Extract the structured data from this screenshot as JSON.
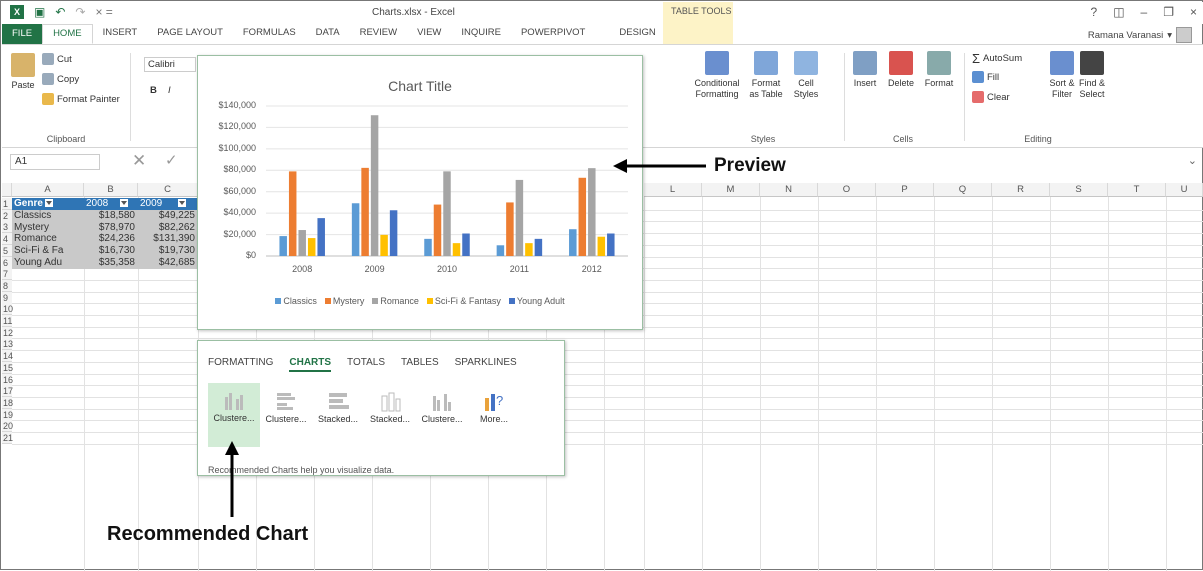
{
  "window": {
    "title": "Charts.xlsx - Excel",
    "context_tab_group": "TABLE TOOLS"
  },
  "ribbon_tabs": [
    "FILE",
    "HOME",
    "INSERT",
    "PAGE LAYOUT",
    "FORMULAS",
    "DATA",
    "REVIEW",
    "VIEW",
    "INQUIRE",
    "POWERPIVOT",
    "DESIGN"
  ],
  "user": {
    "name": "Ramana Varanasi"
  },
  "clipboard": {
    "paste": "Paste",
    "cut": "Cut",
    "copy": "Copy",
    "format_painter": "Format Painter",
    "label": "Clipboard"
  },
  "font": {
    "name": "Calibri",
    "bold": "B",
    "italic": "I"
  },
  "styles": {
    "conditional": "Conditional Formatting",
    "format_table": "Format as Table",
    "cell_styles": "Cell Styles",
    "label": "Styles"
  },
  "cells": {
    "insert": "Insert",
    "delete": "Delete",
    "format": "Format",
    "label": "Cells"
  },
  "editing": {
    "autosum": "AutoSum",
    "fill": "Fill",
    "clear": "Clear",
    "sort": "Sort & Filter",
    "find": "Find & Select",
    "label": "Editing"
  },
  "formula_bar": {
    "name_box": "A1"
  },
  "columns_visible": [
    "A",
    "B",
    "C",
    "L",
    "M",
    "N",
    "O",
    "P",
    "Q",
    "R",
    "S",
    "T",
    "U"
  ],
  "rows": [
    "1",
    "2",
    "3",
    "4",
    "5",
    "6",
    "7",
    "8",
    "9",
    "10",
    "11",
    "12",
    "13",
    "14",
    "15",
    "16",
    "17",
    "18",
    "19",
    "20",
    "21"
  ],
  "table": {
    "headers": [
      "Genre",
      "2008",
      "2009"
    ],
    "rows": [
      [
        "Classics",
        "$18,580",
        "$49,225"
      ],
      [
        "Mystery",
        "$78,970",
        "$82,262"
      ],
      [
        "Romance",
        "$24,236",
        "$131,390"
      ],
      [
        "Sci-Fi & Fa",
        "$16,730",
        "$19,730"
      ],
      [
        "Young Adu",
        "$35,358",
        "$42,685"
      ]
    ]
  },
  "chart_preview": {
    "title": "Chart Title",
    "yticks": [
      "$140,000",
      "$120,000",
      "$100,000",
      "$80,000",
      "$60,000",
      "$40,000",
      "$20,000",
      "$0"
    ],
    "legend": [
      "Classics",
      "Mystery",
      "Romance",
      "Sci-Fi & Fantasy",
      "Young Adult"
    ]
  },
  "chart_data": {
    "type": "bar",
    "title": "Chart Title",
    "categories": [
      "2008",
      "2009",
      "2010",
      "2011",
      "2012"
    ],
    "ylim": [
      0,
      140000
    ],
    "series": [
      {
        "name": "Classics",
        "color": "#5b9bd5",
        "values": [
          18580,
          49225,
          16000,
          10000,
          25000
        ]
      },
      {
        "name": "Mystery",
        "color": "#ed7d31",
        "values": [
          78970,
          82262,
          48000,
          50000,
          73000
        ]
      },
      {
        "name": "Romance",
        "color": "#a5a5a5",
        "values": [
          24236,
          131390,
          79000,
          71000,
          82000
        ]
      },
      {
        "name": "Sci-Fi & Fantasy",
        "color": "#ffc000",
        "values": [
          16730,
          19730,
          12000,
          12000,
          18000
        ]
      },
      {
        "name": "Young Adult",
        "color": "#4472c4",
        "values": [
          35358,
          42685,
          21000,
          16000,
          21000
        ]
      }
    ],
    "legend_position": "bottom",
    "grid": true
  },
  "quick_analysis": {
    "tabs": [
      "FORMATTING",
      "CHARTS",
      "TOTALS",
      "TABLES",
      "SPARKLINES"
    ],
    "active_tab": "CHARTS",
    "items": [
      "Clustere...",
      "Clustere...",
      "Stacked...",
      "Stacked...",
      "Clustere...",
      "More..."
    ],
    "help": "Recommended Charts help you visualize data."
  },
  "annotations": {
    "preview": "Preview",
    "recommended": "Recommended Chart"
  }
}
